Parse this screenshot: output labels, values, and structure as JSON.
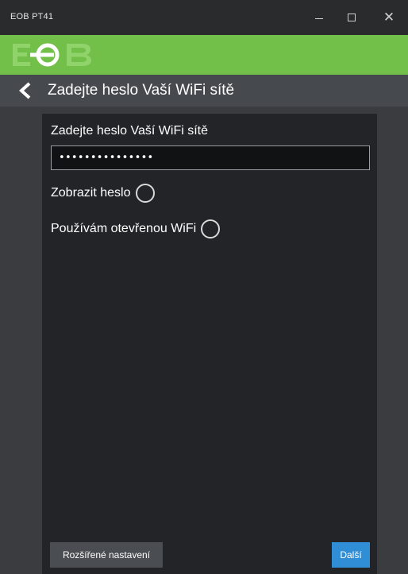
{
  "window": {
    "title": "EOB PT41",
    "minimize_icon": "minimize-icon",
    "maximize_icon": "maximize-icon",
    "close_icon": "close-icon"
  },
  "brand": {
    "logo_text": "EOB",
    "bar_color": "#72c04a"
  },
  "nav": {
    "back_icon": "chevron-left-icon",
    "title": "Zadejte heslo Vaší WiFi sítě"
  },
  "form": {
    "password_label": "Zadejte heslo Vaší WiFi sítě",
    "password_value_masked": "•••••••••••••••",
    "show_password_label": "Zobrazit heslo",
    "open_wifi_label": "Používám otevřenou WiFi"
  },
  "footer": {
    "advanced_label": "Rozšířené nastavení",
    "next_label": "Další",
    "next_color": "#2f8ed6"
  }
}
